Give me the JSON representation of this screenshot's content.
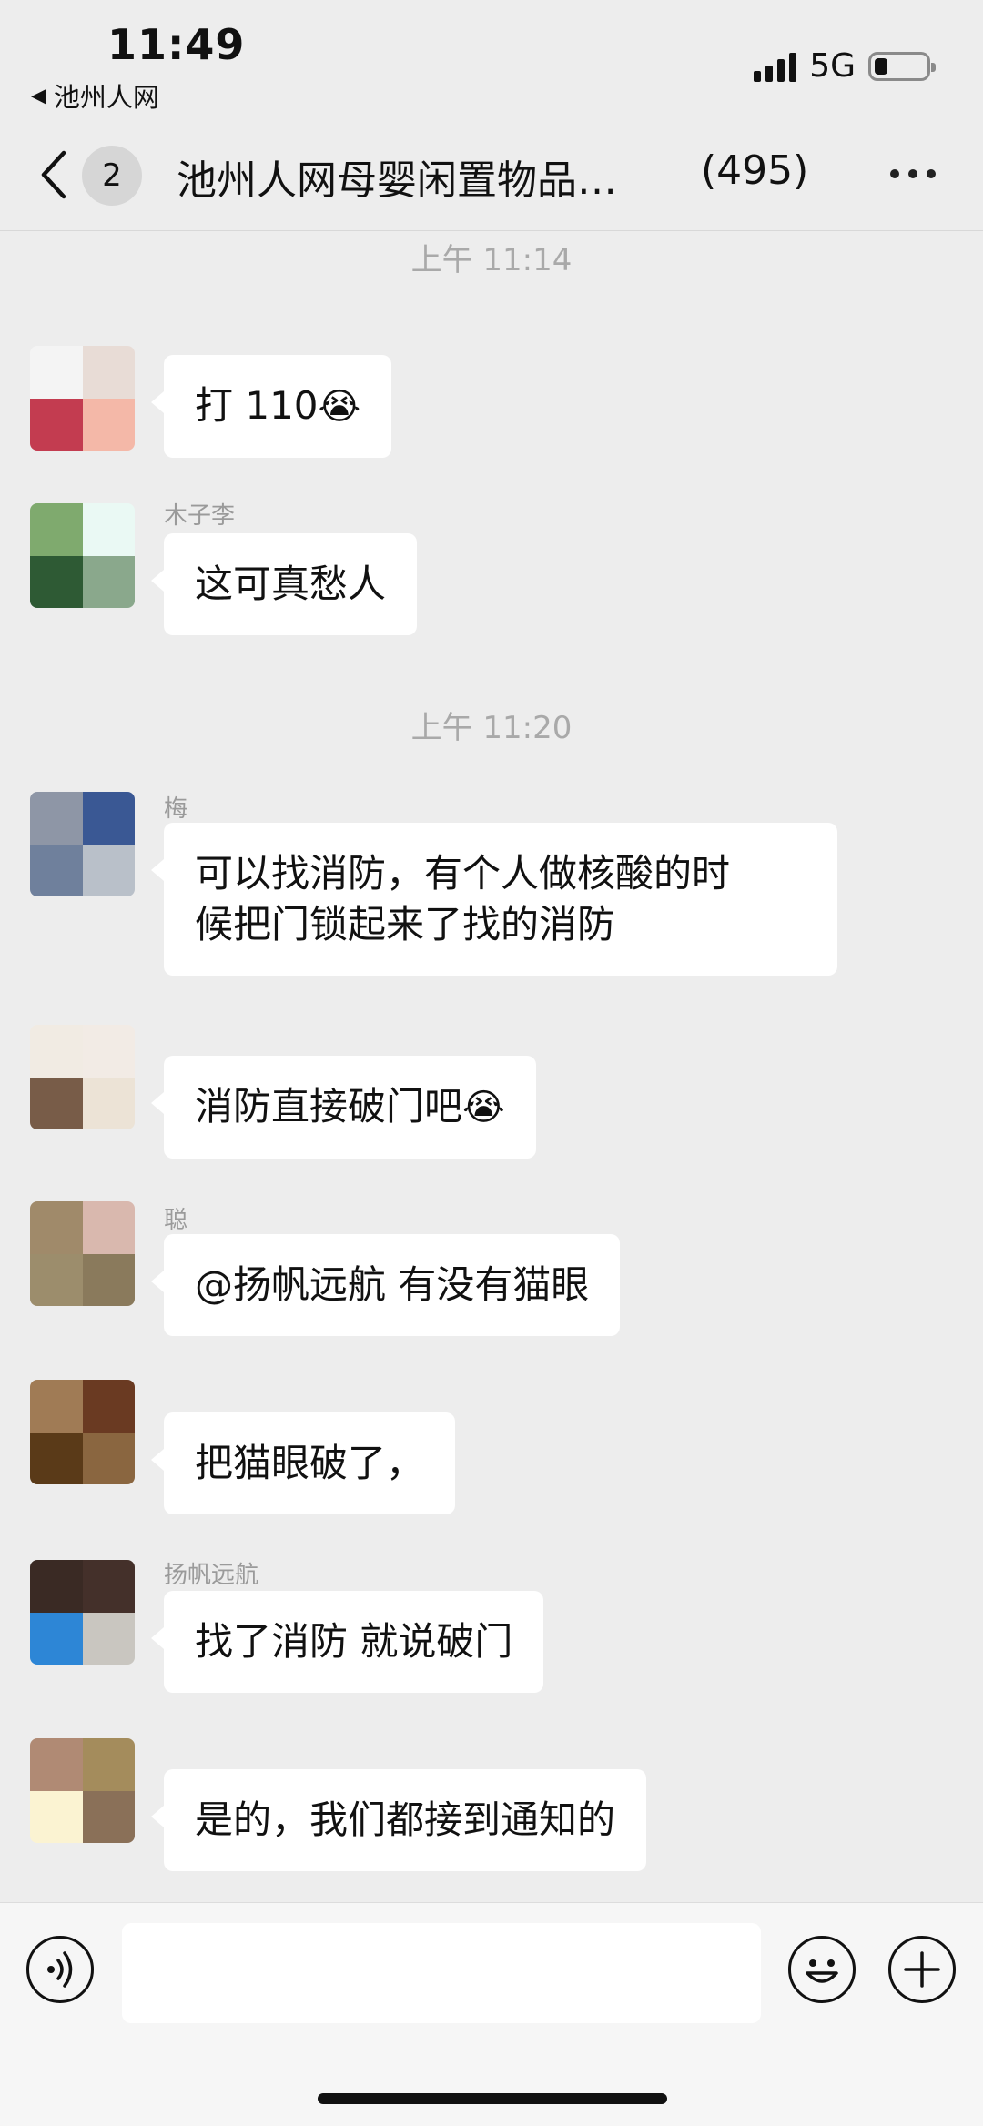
{
  "status_bar": {
    "time": "11:49",
    "back_app": "池州人网",
    "network": "5G"
  },
  "header": {
    "unread_badge": "2",
    "title": "池州人网母婴闲置物品…",
    "member_count": "(495)"
  },
  "messages": {
    "ts1": "上午 11:14",
    "ts2": "上午 11:20",
    "m1": {
      "text": "打 110",
      "emoji": "😭"
    },
    "m2": {
      "nick": "木子李",
      "text": "这可真愁人"
    },
    "m3": {
      "nick": "梅",
      "text_line1": "可以找消防，有个人做核酸的时",
      "text_line2": "候把门锁起来了找的消防"
    },
    "m4": {
      "text": "消防直接破门吧",
      "emoji": "😭"
    },
    "m5": {
      "nick": "聪",
      "text": "@扬帆远航 有没有猫眼"
    },
    "m6": {
      "text": "把猫眼破了，"
    },
    "m7": {
      "nick": "扬帆远航",
      "text": "找了消防  就说破门"
    },
    "m8": {
      "text": "是的，我们都接到通知的"
    }
  },
  "icons": {
    "back": "chevron-left-icon",
    "more": "more-dots-icon",
    "voice": "voice-icon",
    "emoji": "smiley-icon",
    "plus": "plus-icon"
  },
  "colors": {
    "background": "#ededed",
    "bubble": "#ffffff",
    "timestamp": "#a9a9a9"
  }
}
